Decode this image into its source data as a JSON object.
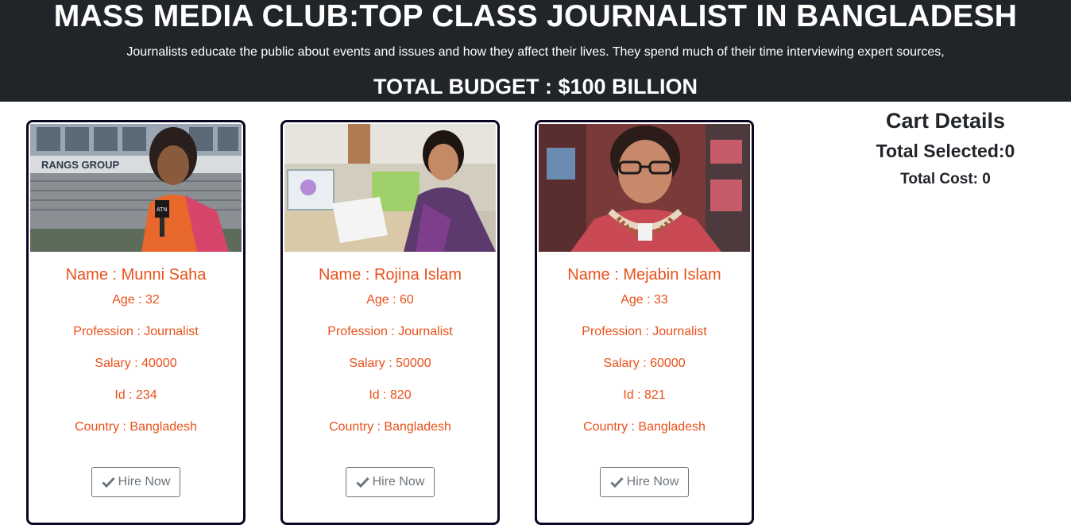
{
  "header": {
    "title": "MASS MEDIA CLUB:TOP CLASS JOURNALIST IN BANGLADESH",
    "tagline": "Journalists educate the public about events and issues and how they affect their lives. They spend much of their time interviewing expert sources,",
    "budget": "TOTAL BUDGET : $100 BILLION"
  },
  "journalists": [
    {
      "name": "Name : Munni Saha",
      "age": "Age : 32",
      "profession": "Profession : Journalist",
      "salary": "Salary : 40000",
      "id": "Id : 234",
      "country": "Country : Bangladesh",
      "hire_label": "Hire Now",
      "photo_caption": "RANGS GROUP"
    },
    {
      "name": "Name : Rojina Islam",
      "age": "Age : 60",
      "profession": "Profession : Journalist",
      "salary": "Salary : 50000",
      "id": "Id : 820",
      "country": "Country : Bangladesh",
      "hire_label": "Hire Now"
    },
    {
      "name": "Name : Mejabin Islam",
      "age": "Age : 33",
      "profession": "Profession : Journalist",
      "salary": "Salary : 60000",
      "id": "Id : 821",
      "country": "Country : Bangladesh",
      "hire_label": "Hire Now"
    }
  ],
  "cart": {
    "title": "Cart Details",
    "total_selected": "Total Selected:0",
    "total_cost": "Total Cost: 0"
  },
  "colors": {
    "header_bg": "#212529",
    "accent": "#e9501a",
    "button_border": "#6c757d",
    "card_border": "#0b0723"
  },
  "icons": {
    "hire_button": "check-icon"
  }
}
